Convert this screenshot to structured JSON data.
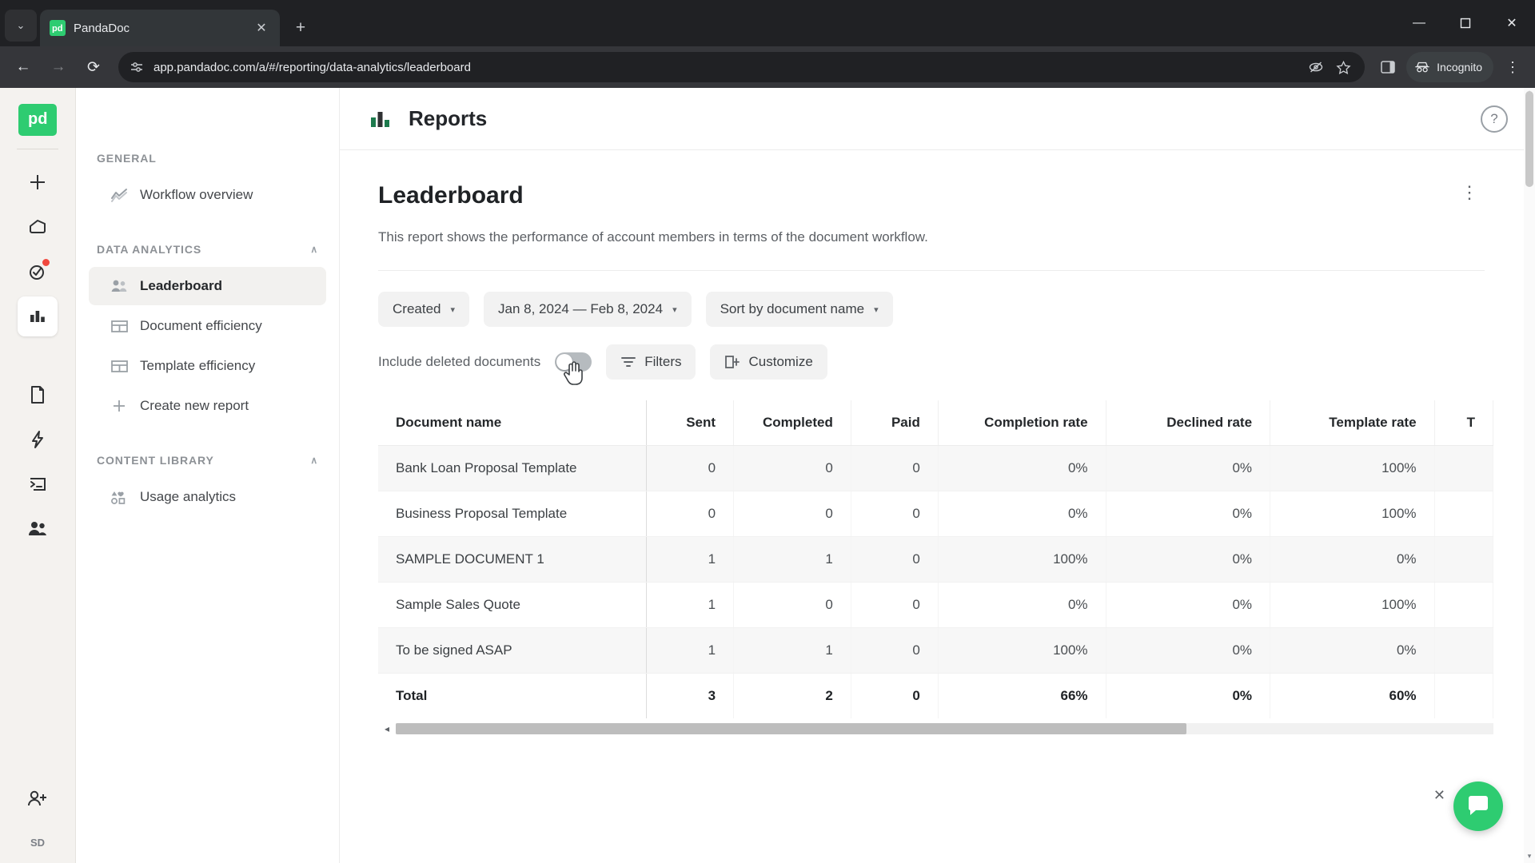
{
  "browser": {
    "tab": {
      "title": "PandaDoc",
      "favicon_text": "pd",
      "close_label": "✕"
    },
    "tab_list_btn": "⌄",
    "new_tab_label": "+",
    "window": {
      "minimize": "—",
      "maximize": "❐",
      "close": "✕"
    },
    "nav": {
      "back": "←",
      "forward": "→",
      "reload": "⟳"
    },
    "url": "app.pandadoc.com/a/#/reporting/data-analytics/leaderboard",
    "profile_label": "Incognito",
    "menu_label": "⋮"
  },
  "rail": {
    "logo_text": "pd",
    "items": [
      {
        "name": "create-new",
        "glyph": "+"
      },
      {
        "name": "home",
        "glyph": "home"
      },
      {
        "name": "tasks",
        "glyph": "check-circle",
        "badge": true
      },
      {
        "name": "reports",
        "glyph": "bar-chart",
        "active": true
      },
      {
        "name": "documents",
        "glyph": "document"
      },
      {
        "name": "automation",
        "glyph": "lightning"
      },
      {
        "name": "forms",
        "glyph": "terminal"
      },
      {
        "name": "contacts",
        "glyph": "people"
      }
    ],
    "invite_label": "invite-user",
    "avatar_initials": "SD"
  },
  "sidebar": {
    "groups": [
      {
        "title": "GENERAL",
        "collapsible": false,
        "items": [
          {
            "label": "Workflow overview",
            "icon": "trend-icon",
            "active": false
          }
        ]
      },
      {
        "title": "DATA ANALYTICS",
        "collapsible": true,
        "chevron": "∧",
        "items": [
          {
            "label": "Leaderboard",
            "icon": "people-icon",
            "active": true
          },
          {
            "label": "Document efficiency",
            "icon": "table-icon",
            "active": false
          },
          {
            "label": "Template efficiency",
            "icon": "table-icon",
            "active": false
          },
          {
            "label": "Create new report",
            "icon": "plus-icon",
            "active": false
          }
        ]
      },
      {
        "title": "CONTENT LIBRARY",
        "collapsible": true,
        "chevron": "∧",
        "items": [
          {
            "label": "Usage analytics",
            "icon": "shapes-icon",
            "active": false
          }
        ]
      }
    ]
  },
  "header": {
    "title": "Reports",
    "icon": "bar-chart-icon",
    "help_label": "?"
  },
  "report": {
    "title": "Leaderboard",
    "description": "This report shows the performance of account members in terms of the document workflow.",
    "more_menu": "⋮",
    "filters": [
      {
        "name": "created-filter",
        "label": "Created",
        "caret": "▾"
      },
      {
        "name": "date-range-filter",
        "label": "Jan 8, 2024 — Feb 8, 2024",
        "caret": "▾"
      },
      {
        "name": "sort-filter",
        "label": "Sort by document name",
        "caret": "▾"
      }
    ],
    "toggle": {
      "label": "Include deleted documents",
      "state": "off"
    },
    "filters_button": "Filters",
    "customize_button": "Customize"
  },
  "chart_data": {
    "type": "table",
    "title": "Leaderboard",
    "columns": [
      "Document name",
      "Sent",
      "Completed",
      "Paid",
      "Completion rate",
      "Declined rate",
      "Template rate",
      "T"
    ],
    "rows": [
      {
        "cells": [
          "Bank Loan Proposal Template",
          "0",
          "0",
          "0",
          "0%",
          "0%",
          "100%",
          ""
        ]
      },
      {
        "cells": [
          "Business Proposal Template",
          "0",
          "0",
          "0",
          "0%",
          "0%",
          "100%",
          ""
        ]
      },
      {
        "cells": [
          "SAMPLE DOCUMENT 1",
          "1",
          "1",
          "0",
          "100%",
          "0%",
          "0%",
          ""
        ]
      },
      {
        "cells": [
          "Sample Sales Quote",
          "1",
          "0",
          "0",
          "0%",
          "0%",
          "100%",
          ""
        ]
      },
      {
        "cells": [
          "To be signed ASAP",
          "1",
          "1",
          "0",
          "100%",
          "0%",
          "0%",
          ""
        ]
      }
    ],
    "total_row": {
      "cells": [
        "Total",
        "3",
        "2",
        "0",
        "66%",
        "0%",
        "60%",
        ""
      ]
    }
  },
  "scrollbars": {
    "left_arrow": "◂",
    "up_arrow": "▴",
    "down_arrow": "▾"
  },
  "chat": {
    "close_label": "✕",
    "icon": "chat-icon"
  },
  "colors": {
    "brand_green": "#2ecc71",
    "accent_red": "#f0483e",
    "chrome_dark": "#202124"
  }
}
